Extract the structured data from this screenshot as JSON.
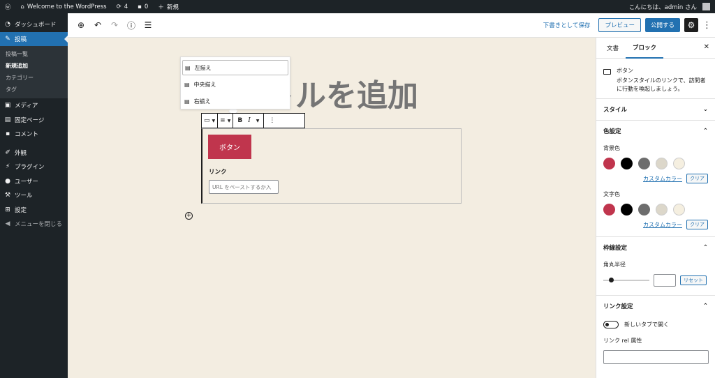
{
  "admin_bar": {
    "site_name": "Welcome to the WordPress",
    "updates_count": "4",
    "comments_count": "0",
    "new_label": "新規",
    "greeting": "こんにちは、admin さん"
  },
  "sidebar": {
    "items": [
      {
        "label": "ダッシュボード",
        "icon": "dashboard-icon"
      },
      {
        "label": "投稿",
        "icon": "pin-icon"
      },
      {
        "label": "メディア",
        "icon": "media-icon"
      },
      {
        "label": "固定ページ",
        "icon": "page-icon"
      },
      {
        "label": "コメント",
        "icon": "comment-icon"
      },
      {
        "label": "外観",
        "icon": "brush-icon"
      },
      {
        "label": "プラグイン",
        "icon": "plugin-icon"
      },
      {
        "label": "ユーザー",
        "icon": "user-icon"
      },
      {
        "label": "ツール",
        "icon": "wrench-icon"
      },
      {
        "label": "設定",
        "icon": "settings-icon"
      }
    ],
    "posts_submenu": [
      "投稿一覧",
      "新規追加",
      "カテゴリー",
      "タグ"
    ],
    "collapse_label": "メニューを閉じる"
  },
  "toolbar": {
    "save_draft": "下書きとして保存",
    "preview": "プレビュー",
    "publish": "公開する"
  },
  "editor": {
    "title_visible": "トルを追加",
    "align_options": [
      "左揃え",
      "中央揃え",
      "右揃え"
    ],
    "button_text": "ボタン",
    "link_label": "リンク",
    "url_placeholder": "URL をペーストするか入"
  },
  "inspector": {
    "tabs": [
      "文書",
      "ブロック"
    ],
    "block_name": "ボタン",
    "block_description": "ボタンスタイルのリンクで、訪問者に行動を喚起しましょう。",
    "styles_title": "スタイル",
    "color_title": "色設定",
    "background_label": "背景色",
    "text_label": "文字色",
    "palette": [
      "#c0354d",
      "#000000",
      "#6d6d6d",
      "#dcd7ca",
      "#f5efe0"
    ],
    "custom_color": "カスタムカラー",
    "clear": "クリア",
    "border_title": "枠線設定",
    "radius_label": "角丸半径",
    "reset": "リセット",
    "link_title": "リンク設定",
    "new_tab_label": "新しいタブで開く",
    "rel_label": "リンク rel 属性"
  },
  "colors": {
    "accent": "#2271b1",
    "button": "#c0354d",
    "admin_dark": "#1d2327"
  }
}
